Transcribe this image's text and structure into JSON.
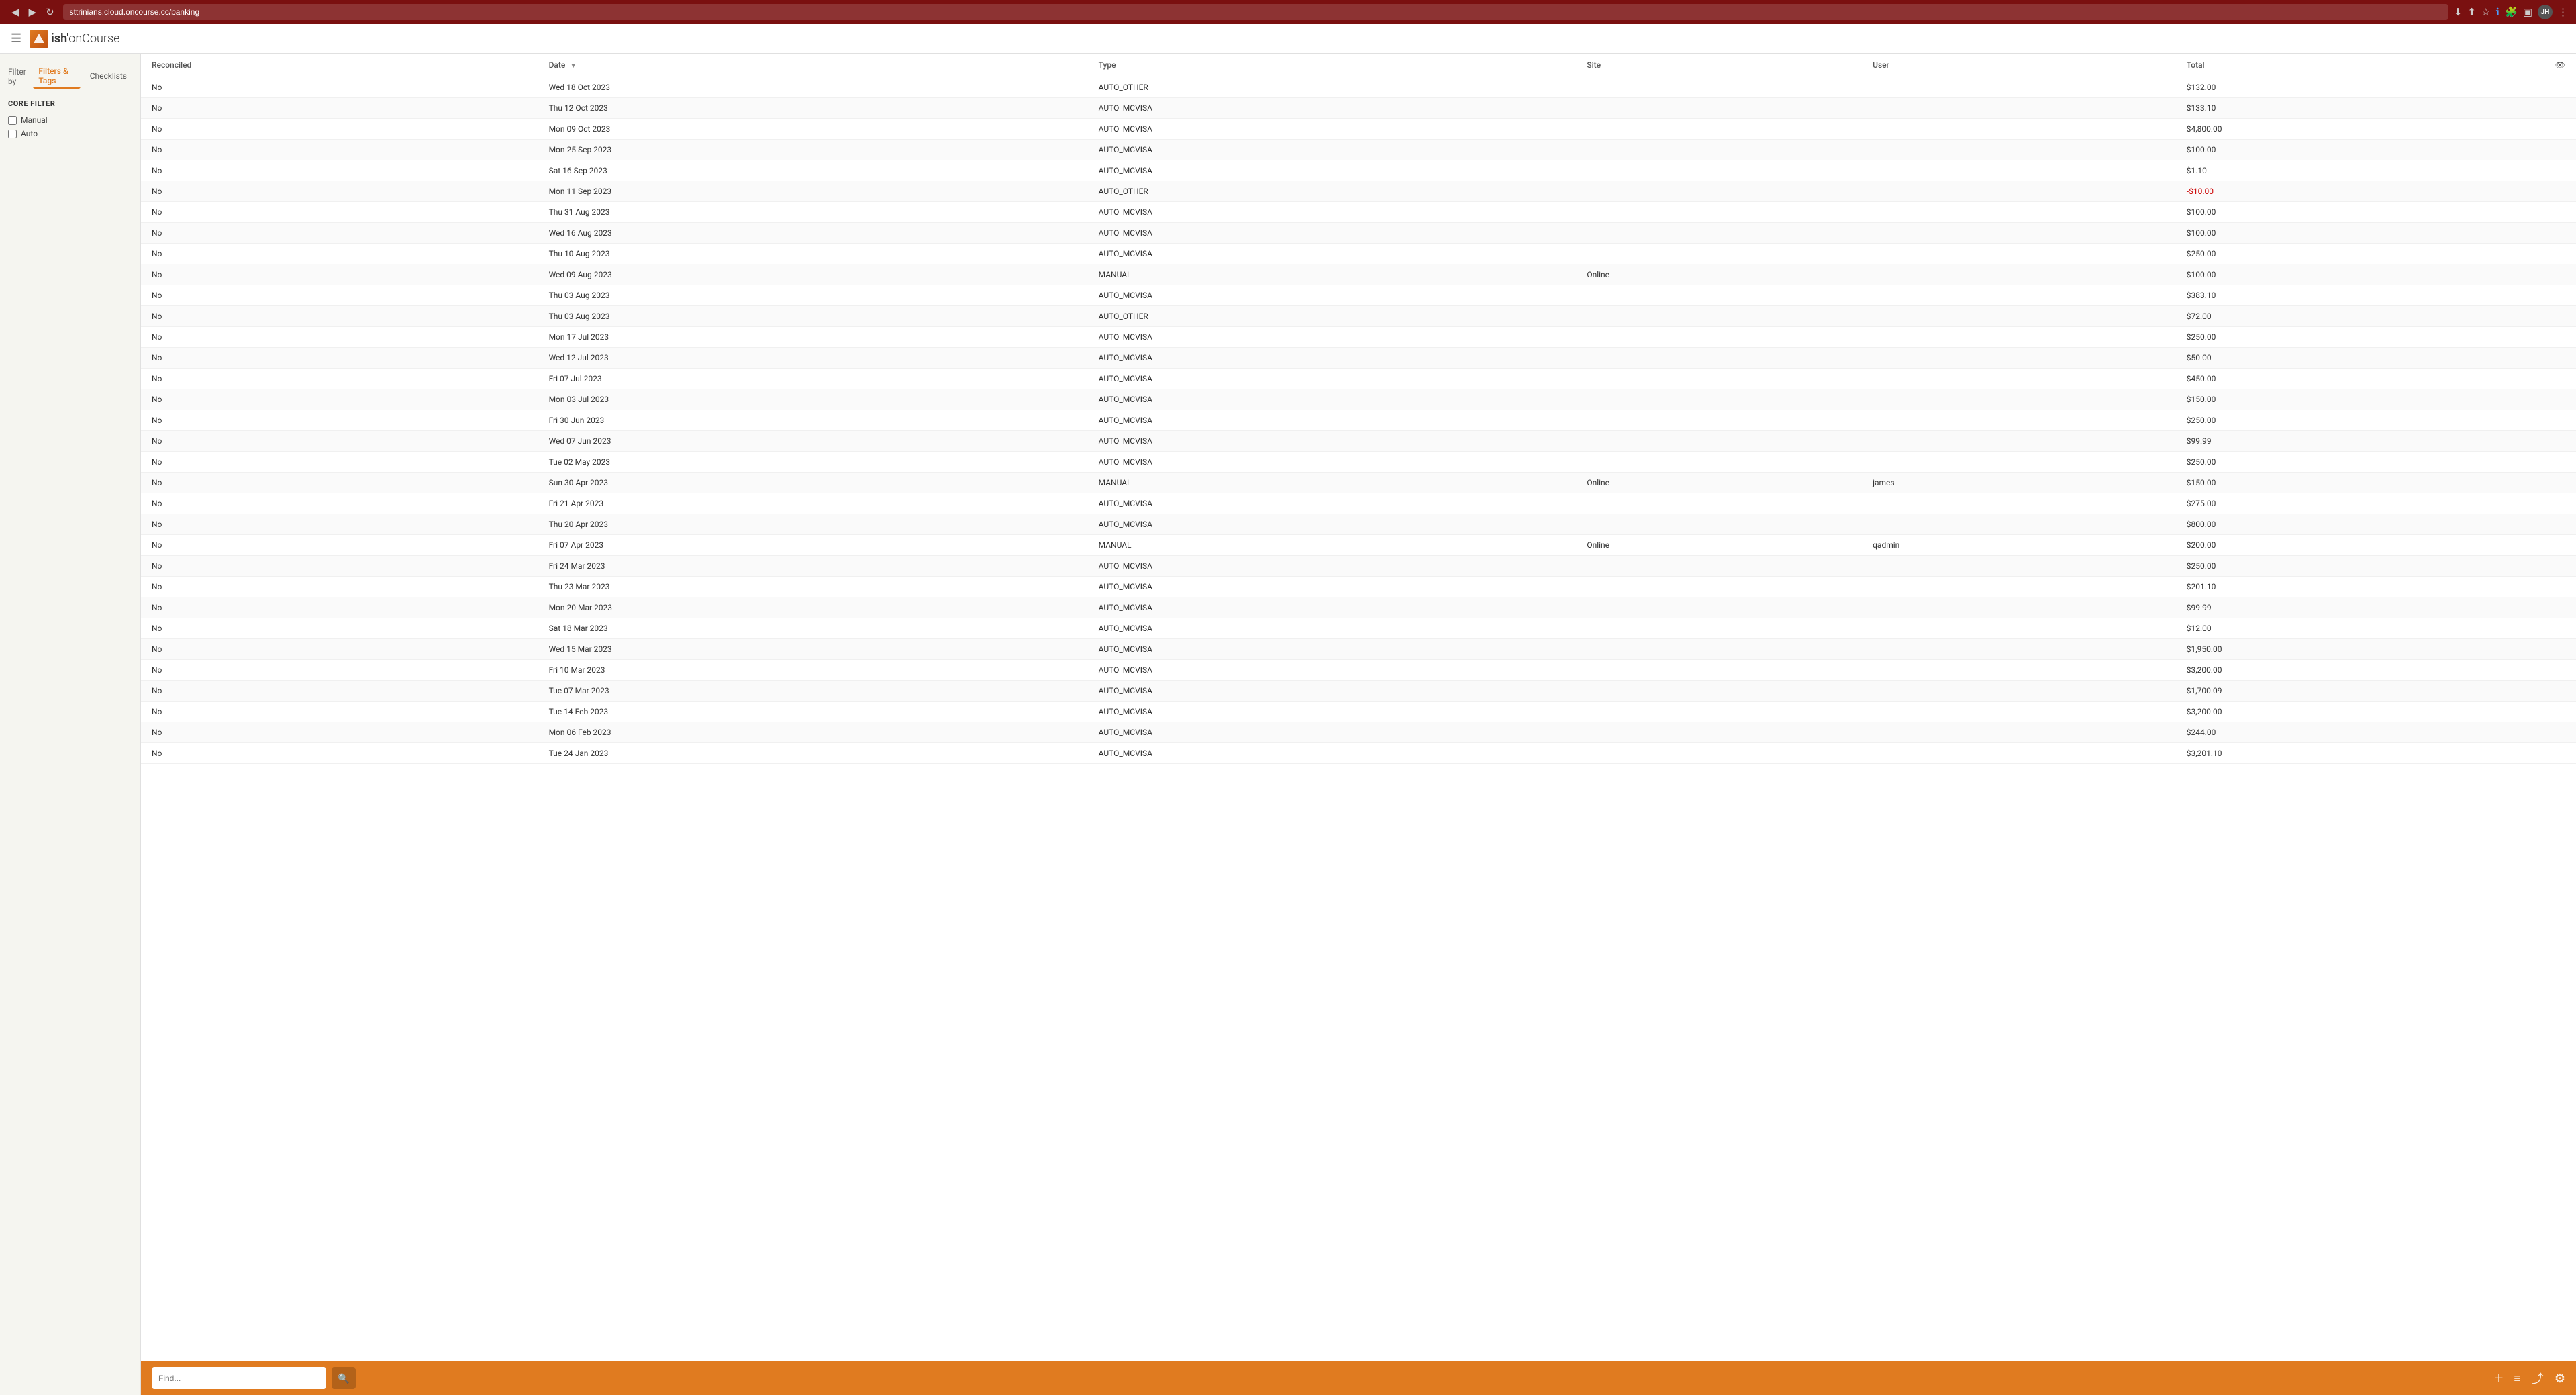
{
  "browser": {
    "url": "sttrinians.cloud.oncourse.cc/banking",
    "back_icon": "◀",
    "forward_icon": "▶",
    "refresh_icon": "↻"
  },
  "app": {
    "title": "ish onCourse",
    "logo_pre": "ish'",
    "logo_post": "onCourse"
  },
  "sidebar": {
    "filter_by_label": "Filter by",
    "tabs": [
      {
        "id": "filters-tags",
        "label": "Filters & Tags",
        "active": true
      },
      {
        "id": "checklists",
        "label": "Checklists",
        "active": false
      }
    ],
    "core_filter": {
      "title": "CORE FILTER",
      "options": [
        {
          "id": "manual",
          "label": "Manual",
          "checked": false
        },
        {
          "id": "auto",
          "label": "Auto",
          "checked": false
        }
      ]
    }
  },
  "table": {
    "columns": [
      {
        "id": "reconciled",
        "label": "Reconciled",
        "sortable": false
      },
      {
        "id": "date",
        "label": "Date",
        "sortable": true
      },
      {
        "id": "type",
        "label": "Type",
        "sortable": false
      },
      {
        "id": "site",
        "label": "Site",
        "sortable": false
      },
      {
        "id": "user",
        "label": "User",
        "sortable": false
      },
      {
        "id": "total",
        "label": "Total",
        "sortable": false
      }
    ],
    "rows": [
      {
        "reconciled": "No",
        "date": "Wed 18 Oct 2023",
        "type": "AUTO_OTHER",
        "site": "",
        "user": "",
        "total": "$132.00"
      },
      {
        "reconciled": "No",
        "date": "Thu 12 Oct 2023",
        "type": "AUTO_MCVISA",
        "site": "",
        "user": "",
        "total": "$133.10"
      },
      {
        "reconciled": "No",
        "date": "Mon 09 Oct 2023",
        "type": "AUTO_MCVISA",
        "site": "",
        "user": "",
        "total": "$4,800.00"
      },
      {
        "reconciled": "No",
        "date": "Mon 25 Sep 2023",
        "type": "AUTO_MCVISA",
        "site": "",
        "user": "",
        "total": "$100.00"
      },
      {
        "reconciled": "No",
        "date": "Sat 16 Sep 2023",
        "type": "AUTO_MCVISA",
        "site": "",
        "user": "",
        "total": "$1.10"
      },
      {
        "reconciled": "No",
        "date": "Mon 11 Sep 2023",
        "type": "AUTO_OTHER",
        "site": "",
        "user": "",
        "total": "-$10.00"
      },
      {
        "reconciled": "No",
        "date": "Thu 31 Aug 2023",
        "type": "AUTO_MCVISA",
        "site": "",
        "user": "",
        "total": "$100.00"
      },
      {
        "reconciled": "No",
        "date": "Wed 16 Aug 2023",
        "type": "AUTO_MCVISA",
        "site": "",
        "user": "",
        "total": "$100.00"
      },
      {
        "reconciled": "No",
        "date": "Thu 10 Aug 2023",
        "type": "AUTO_MCVISA",
        "site": "",
        "user": "",
        "total": "$250.00"
      },
      {
        "reconciled": "No",
        "date": "Wed 09 Aug 2023",
        "type": "MANUAL",
        "site": "Online",
        "user": "",
        "total": "$100.00"
      },
      {
        "reconciled": "No",
        "date": "Thu 03 Aug 2023",
        "type": "AUTO_MCVISA",
        "site": "",
        "user": "",
        "total": "$383.10"
      },
      {
        "reconciled": "No",
        "date": "Thu 03 Aug 2023",
        "type": "AUTO_OTHER",
        "site": "",
        "user": "",
        "total": "$72.00"
      },
      {
        "reconciled": "No",
        "date": "Mon 17 Jul 2023",
        "type": "AUTO_MCVISA",
        "site": "",
        "user": "",
        "total": "$250.00"
      },
      {
        "reconciled": "No",
        "date": "Wed 12 Jul 2023",
        "type": "AUTO_MCVISA",
        "site": "",
        "user": "",
        "total": "$50.00"
      },
      {
        "reconciled": "No",
        "date": "Fri 07 Jul 2023",
        "type": "AUTO_MCVISA",
        "site": "",
        "user": "",
        "total": "$450.00"
      },
      {
        "reconciled": "No",
        "date": "Mon 03 Jul 2023",
        "type": "AUTO_MCVISA",
        "site": "",
        "user": "",
        "total": "$150.00"
      },
      {
        "reconciled": "No",
        "date": "Fri 30 Jun 2023",
        "type": "AUTO_MCVISA",
        "site": "",
        "user": "",
        "total": "$250.00"
      },
      {
        "reconciled": "No",
        "date": "Wed 07 Jun 2023",
        "type": "AUTO_MCVISA",
        "site": "",
        "user": "",
        "total": "$99.99"
      },
      {
        "reconciled": "No",
        "date": "Tue 02 May 2023",
        "type": "AUTO_MCVISA",
        "site": "",
        "user": "",
        "total": "$250.00"
      },
      {
        "reconciled": "No",
        "date": "Sun 30 Apr 2023",
        "type": "MANUAL",
        "site": "Online",
        "user": "james",
        "total": "$150.00"
      },
      {
        "reconciled": "No",
        "date": "Fri 21 Apr 2023",
        "type": "AUTO_MCVISA",
        "site": "",
        "user": "",
        "total": "$275.00"
      },
      {
        "reconciled": "No",
        "date": "Thu 20 Apr 2023",
        "type": "AUTO_MCVISA",
        "site": "",
        "user": "",
        "total": "$800.00"
      },
      {
        "reconciled": "No",
        "date": "Fri 07 Apr 2023",
        "type": "MANUAL",
        "site": "Online",
        "user": "qadmin",
        "total": "$200.00"
      },
      {
        "reconciled": "No",
        "date": "Fri 24 Mar 2023",
        "type": "AUTO_MCVISA",
        "site": "",
        "user": "",
        "total": "$250.00"
      },
      {
        "reconciled": "No",
        "date": "Thu 23 Mar 2023",
        "type": "AUTO_MCVISA",
        "site": "",
        "user": "",
        "total": "$201.10"
      },
      {
        "reconciled": "No",
        "date": "Mon 20 Mar 2023",
        "type": "AUTO_MCVISA",
        "site": "",
        "user": "",
        "total": "$99.99"
      },
      {
        "reconciled": "No",
        "date": "Sat 18 Mar 2023",
        "type": "AUTO_MCVISA",
        "site": "",
        "user": "",
        "total": "$12.00"
      },
      {
        "reconciled": "No",
        "date": "Wed 15 Mar 2023",
        "type": "AUTO_MCVISA",
        "site": "",
        "user": "",
        "total": "$1,950.00"
      },
      {
        "reconciled": "No",
        "date": "Fri 10 Mar 2023",
        "type": "AUTO_MCVISA",
        "site": "",
        "user": "",
        "total": "$3,200.00"
      },
      {
        "reconciled": "No",
        "date": "Tue 07 Mar 2023",
        "type": "AUTO_MCVISA",
        "site": "",
        "user": "",
        "total": "$1,700.09"
      },
      {
        "reconciled": "No",
        "date": "Tue 14 Feb 2023",
        "type": "AUTO_MCVISA",
        "site": "",
        "user": "",
        "total": "$3,200.00"
      },
      {
        "reconciled": "No",
        "date": "Mon 06 Feb 2023",
        "type": "AUTO_MCVISA",
        "site": "",
        "user": "",
        "total": "$244.00"
      },
      {
        "reconciled": "No",
        "date": "Tue 24 Jan 2023",
        "type": "AUTO_MCVISA",
        "site": "",
        "user": "",
        "total": "$3,201.10"
      }
    ]
  },
  "bottom_bar": {
    "search_placeholder": "Find...",
    "add_label": "+",
    "list_icon": "≡",
    "share_icon": "⤴",
    "settings_icon": "⚙"
  },
  "colors": {
    "top_bar_bg": "#7a1010",
    "brand_orange": "#e07b20",
    "sidebar_bg": "#f5f5f0"
  }
}
